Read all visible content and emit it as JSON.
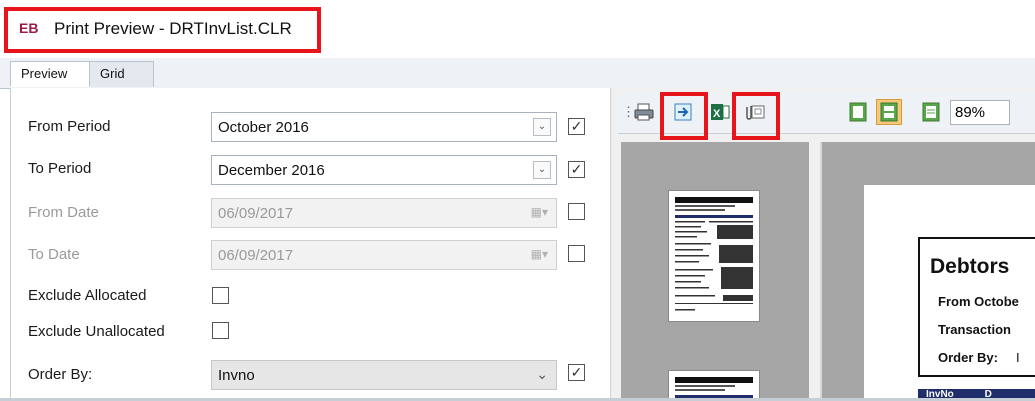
{
  "window": {
    "logo": "EB",
    "title": "Print Preview - DRTInvList.CLR"
  },
  "tabs": [
    {
      "label": "Preview"
    },
    {
      "label": "Grid"
    }
  ],
  "form": {
    "from_period": {
      "label": "From Period",
      "value": "October 2016",
      "checked": true
    },
    "to_period": {
      "label": "To Period",
      "value": "December 2016",
      "checked": true
    },
    "from_date": {
      "label": "From Date",
      "value": "06/09/2017",
      "checked": false
    },
    "to_date": {
      "label": "To Date",
      "value": "06/09/2017",
      "checked": false
    },
    "exclude_allocated": {
      "label": "Exclude Allocated",
      "checked": false
    },
    "exclude_unallocated": {
      "label": "Exclude Unallocated",
      "checked": false
    },
    "order_by": {
      "label": "Order By:",
      "value": "Invno",
      "checked": true
    }
  },
  "toolbar": {
    "icons": [
      "print-icon",
      "export-icon",
      "excel-icon",
      "email-attachment-icon",
      "single-page-icon",
      "page-width-icon",
      "whole-page-icon"
    ],
    "zoom": "89%"
  },
  "report": {
    "title": "Debtors",
    "line1": "From Octobe",
    "line2": "Transaction",
    "line3": "Order By:",
    "line3_value": "I",
    "band_col1": "InvNo",
    "band_col2": "D"
  },
  "colors": {
    "highlight": "#e8141b",
    "accent": "#9b1c4a",
    "band": "#1f2d6b"
  }
}
